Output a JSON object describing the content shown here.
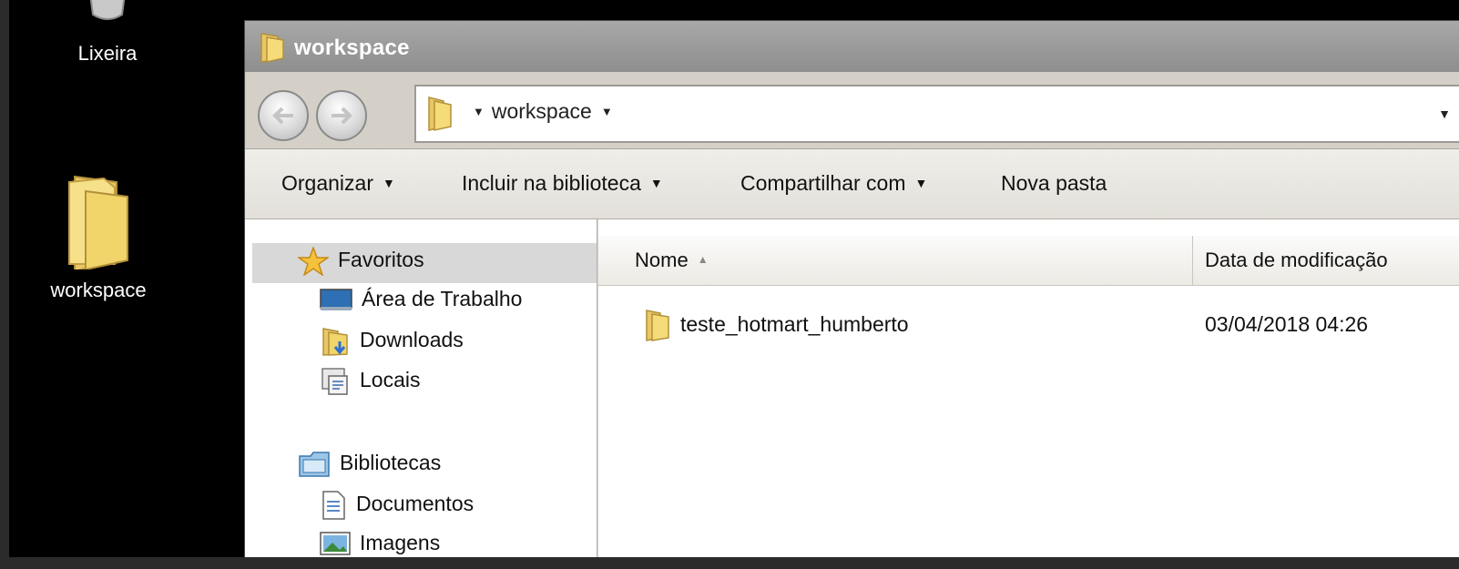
{
  "desktop": {
    "icons": [
      {
        "label": "Lixeira",
        "icon": "recycle-bin-icon"
      },
      {
        "label": "workspace",
        "icon": "folder-icon"
      }
    ]
  },
  "window": {
    "title": "workspace",
    "address": {
      "path": "workspace"
    },
    "toolbar": {
      "organize": "Organizar",
      "include_library": "Incluir na biblioteca",
      "share_with": "Compartilhar com",
      "new_folder": "Nova pasta"
    },
    "navpane": {
      "favorites": {
        "label": "Favoritos",
        "items": [
          "Área de Trabalho",
          "Downloads",
          "Locais"
        ]
      },
      "libraries": {
        "label": "Bibliotecas",
        "items": [
          "Documentos",
          "Imagens"
        ]
      }
    },
    "columns": {
      "name": "Nome",
      "date_modified": "Data de modificação"
    },
    "files": [
      {
        "name": "teste_hotmart_humberto",
        "date": "03/04/2018 04:26",
        "icon": "folder-icon"
      }
    ]
  },
  "colors": {
    "desktop_bg": "#000000",
    "titlebar": "#9a9a9a",
    "folder_yellow": "#f2d56a"
  }
}
